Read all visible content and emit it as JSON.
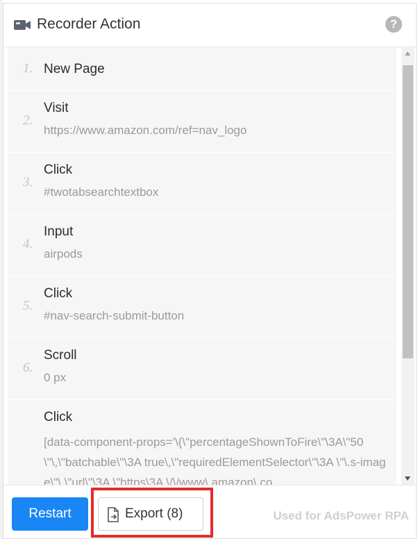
{
  "header": {
    "title": "Recorder Action",
    "title_icon": "video-camera-icon",
    "help_icon": "question-circle-icon",
    "help_glyph": "?"
  },
  "steps": [
    {
      "num": "1.",
      "name": "New Page",
      "detail": ""
    },
    {
      "num": "2.",
      "name": "Visit",
      "detail": "https://www.amazon.com/ref=nav_logo"
    },
    {
      "num": "3.",
      "name": "Click",
      "detail": "#twotabsearchtextbox"
    },
    {
      "num": "4.",
      "name": "Input",
      "detail": "airpods"
    },
    {
      "num": "5.",
      "name": "Click",
      "detail": "#nav-search-submit-button"
    },
    {
      "num": "6.",
      "name": "Scroll",
      "detail": "0 px"
    },
    {
      "num": "",
      "name": "Click",
      "detail": "[data-component-props='\\{\\\"percentageShownToFire\\\"\\3A\\\"50\\\"\\,\\\"batchable\\\"\\3A true\\,\\\"requiredElementSelector\\\"\\3A \\\"\\.s-image\\\"\\,\\\"url\\\"\\3A \\\"https\\3A \\/\\/www\\.amazon\\.co"
    }
  ],
  "footer": {
    "restart_label": "Restart",
    "export_label": "Export (8)",
    "export_icon": "file-export-icon",
    "brand_text": "Used for AdsPower RPA"
  },
  "colors": {
    "primary": "#1a86f5",
    "highlight_box": "#e22c2c",
    "step_bg": "#f6f6f6"
  }
}
